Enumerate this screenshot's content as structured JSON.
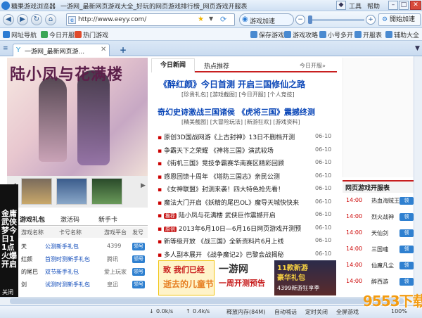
{
  "window": {
    "app_name": "糖果游戏浏览器",
    "title": "一游网_最新网页游戏大全_好玩的网页游戏排行榜_网页游戏开服表",
    "menu": [
      "工具",
      "帮助"
    ]
  },
  "nav": {
    "url": "http://www.eeyy.com/",
    "speed_label": "游戏加速",
    "accel_label": "開始加速"
  },
  "bookmarks": [
    {
      "label": "网址导航",
      "icon": "globe-icon",
      "color": "#2b7bd3"
    },
    {
      "label": "今日开服",
      "icon": "clock-icon",
      "color": "#3aa655"
    },
    {
      "label": "热门游戏",
      "icon": "fire-icon",
      "color": "#e04a2a"
    }
  ],
  "tools": [
    {
      "label": "保存游戏",
      "icon": "save-icon"
    },
    {
      "label": "游戏攻略",
      "icon": "book-icon"
    },
    {
      "label": "小号多开",
      "icon": "users-icon"
    },
    {
      "label": "开服表",
      "icon": "table-icon"
    },
    {
      "label": "辅助大全",
      "icon": "tool-icon"
    }
  ],
  "tab": {
    "title": "一游网_最新网页游..."
  },
  "banner": {
    "logo_text": "陆小凤与花满楼"
  },
  "ad_vertical": {
    "text": "金庸武侠梦今日11点火爆开启",
    "close": "关闭"
  },
  "left_tabs": [
    "游戏礼包",
    "激活码",
    "新手卡"
  ],
  "left_table": {
    "headers": [
      "游戏名称",
      "卡号名称",
      "游戏平台",
      "发号"
    ],
    "rows": [
      {
        "game": "天",
        "card": "公测新手礼包",
        "platform": "4399",
        "action": "领号"
      },
      {
        "game": "红颜",
        "card": "首测时测新手礼包",
        "platform": "腾讯",
        "action": "领号"
      },
      {
        "game": "的尾巴",
        "card": "双节新手礼包",
        "platform": "爱上玩家",
        "action": "领号"
      },
      {
        "game": "剑",
        "card": "试测时测新手礼包",
        "platform": "皇迅",
        "action": "领号"
      }
    ]
  },
  "middle": {
    "tabs": [
      "今日新闻",
      "热点推荐"
    ],
    "more": "今日开服»",
    "headline1": {
      "title": "《醉红颜》今日首测 开启三国修仙之路",
      "sub": "[珍贵礼包] [游戏截图] [今日开服] [个人竞技]"
    },
    "headline2": {
      "title": "奇幻史诗激战三国诸侯 《虎将三国》震撼终测",
      "sub": "[精美截图] [大冒险玩法] [新游狂欢] [游戏资料]"
    },
    "news": [
      {
        "text": "原创3D国战网游《上古封神》13日不删档开测",
        "date": "06-10",
        "tag": ""
      },
      {
        "text": "争霸天下之荣耀 《神将三国》演武较场",
        "date": "06-10",
        "tag": ""
      },
      {
        "text": "《街机三国》竞技争霸赛华南赛区精彩回顾",
        "date": "06-10",
        "tag": ""
      },
      {
        "text": "感恩回馈十周年 《塔防三国志》亲民公测",
        "date": "06-10",
        "tag": ""
      },
      {
        "text": "《女神联盟》封测来袭！四大特色抢先看！",
        "date": "06-10",
        "tag": ""
      },
      {
        "text": "魔法大门开启《妖精的尾巴OL》魔导天城快快来",
        "date": "06-10",
        "tag": ""
      },
      {
        "text": "陆小凤与花满楼 武侠巨作震撼开启",
        "date": "06-10",
        "tag": "推荐"
      },
      {
        "text": "2013年6月10日—6月16日网页游戏开测预",
        "date": "06-10",
        "tag": "原创"
      },
      {
        "text": "新等级开放 《战三国》全新资料片6月上线",
        "date": "06-10",
        "tag": ""
      },
      {
        "text": "多人副本展开 《战争魔记2》巴黎会战揭秘",
        "date": "06-10",
        "tag": ""
      }
    ],
    "ads": [
      {
        "line1": "致 我们已经",
        "line2": "逝去的儿童节"
      },
      {
        "line1": "一游网",
        "line2": "一周开测预告"
      },
      {
        "line1": "11款新游",
        "line2": "豪华礼包",
        "line3": "4399新游狂享季"
      }
    ]
  },
  "right_table": {
    "title": "网页游戏开服表",
    "rows": [
      {
        "time": "14:00",
        "server": "热血海贼王",
        "action": "领"
      },
      {
        "time": "14:00",
        "server": "烈火战神",
        "action": "领"
      },
      {
        "time": "14:00",
        "server": "天仙剑",
        "action": "领"
      },
      {
        "time": "14:00",
        "server": "三国魂",
        "action": "领"
      },
      {
        "time": "14:00",
        "server": "仙魔凡尘",
        "action": "领"
      },
      {
        "time": "14:00",
        "server": "醉西游",
        "action": "领"
      }
    ]
  },
  "status": {
    "down": "0.0k/s",
    "up": "0.4k/s",
    "memory": "释放内存(84M)",
    "items": [
      "自动喊话",
      "定时关闭",
      "全屏游戏"
    ],
    "zoom": "100%"
  },
  "watermark": "9553下载",
  "colors": {
    "accent": "#c81f1f",
    "link": "#0b47b8",
    "brand": "#2b7bd3"
  }
}
